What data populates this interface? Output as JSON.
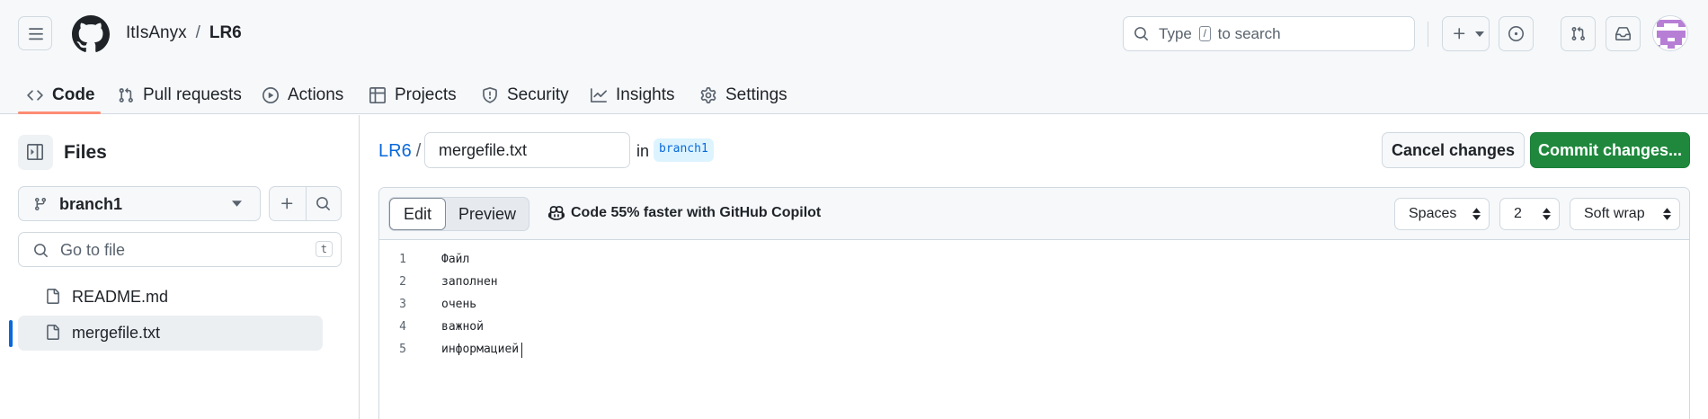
{
  "header": {
    "owner": "ItIsAnyx",
    "separator": "/",
    "repo": "LR6",
    "search": {
      "prefix": "Type",
      "key": "/",
      "suffix": "to search"
    }
  },
  "nav": {
    "tabs": [
      {
        "label": "Code",
        "icon": "code-icon",
        "selected": true
      },
      {
        "label": "Pull requests",
        "icon": "git-pull-request-icon"
      },
      {
        "label": "Actions",
        "icon": "play-icon"
      },
      {
        "label": "Projects",
        "icon": "table-icon"
      },
      {
        "label": "Security",
        "icon": "shield-icon"
      },
      {
        "label": "Insights",
        "icon": "graph-icon"
      },
      {
        "label": "Settings",
        "icon": "gear-icon"
      }
    ]
  },
  "sidebar": {
    "title": "Files",
    "branch": "branch1",
    "goto_placeholder": "Go to file",
    "goto_key": "t",
    "files": [
      {
        "name": "README.md",
        "active": false
      },
      {
        "name": "mergefile.txt",
        "active": true
      }
    ]
  },
  "editor": {
    "repo": "LR6",
    "separator": "/",
    "filename": "mergefile.txt",
    "in_label": "in",
    "branch": "branch1",
    "cancel_label": "Cancel changes",
    "commit_label": "Commit changes...",
    "tab_edit": "Edit",
    "tab_preview": "Preview",
    "copilot_text": "Code 55% faster with GitHub Copilot",
    "indent_mode": "Spaces",
    "indent_size": "2",
    "wrap_mode": "Soft wrap",
    "lines": [
      {
        "n": "1",
        "text": "Файл"
      },
      {
        "n": "2",
        "text": "заполнен"
      },
      {
        "n": "3",
        "text": "очень"
      },
      {
        "n": "4",
        "text": "важной"
      },
      {
        "n": "5",
        "text": "информацией"
      }
    ]
  },
  "colors": {
    "accent_link": "#0969da",
    "commit_green": "#1f883d",
    "tab_underline": "#fd8c73"
  }
}
